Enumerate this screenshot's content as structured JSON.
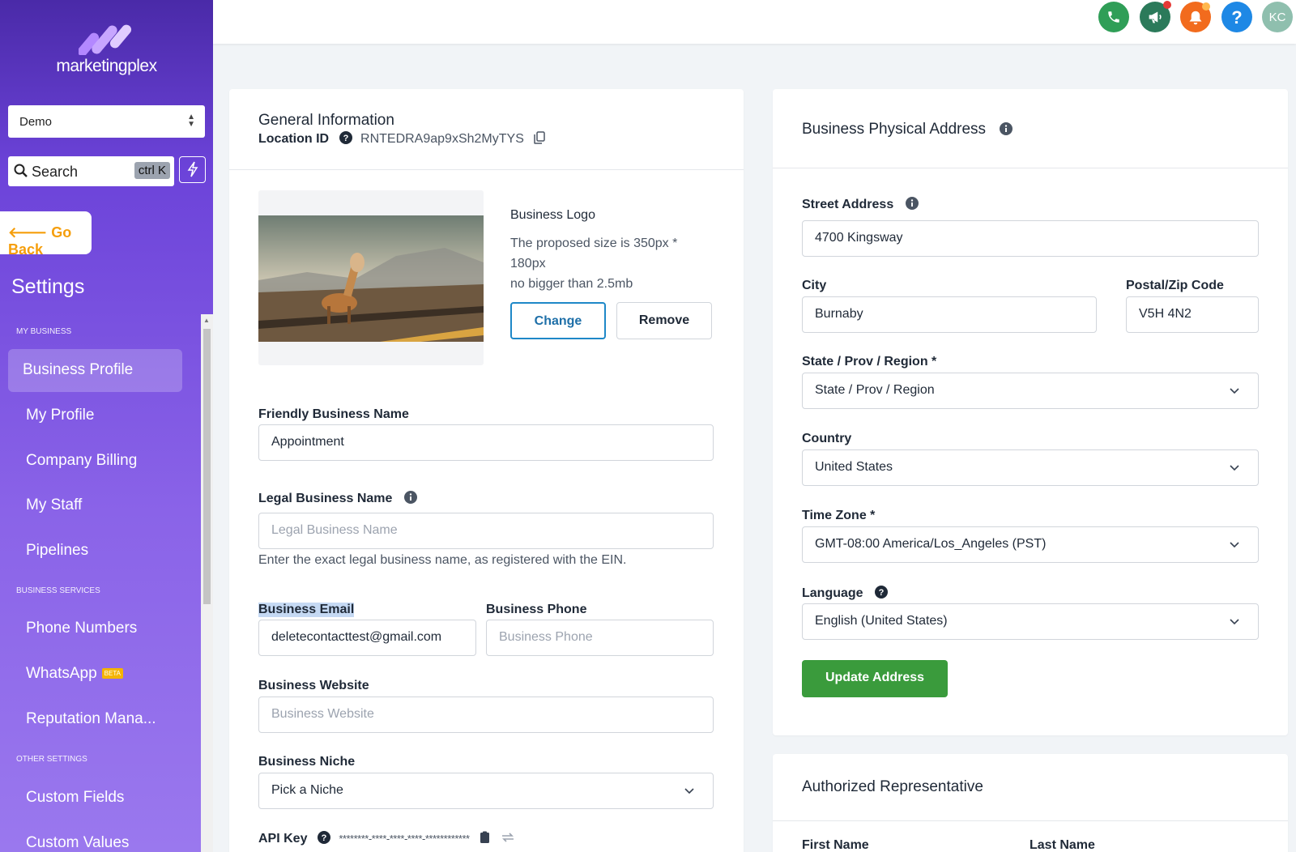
{
  "brand": {
    "name": "marketingplex"
  },
  "sidebar": {
    "location": "Demo",
    "search_label": "Search",
    "search_shortcut": "ctrl K",
    "go_back": "Go Back",
    "title": "Settings",
    "sections": {
      "my_business": "MY BUSINESS",
      "business_services": "BUSINESS SERVICES",
      "other_settings": "OTHER SETTINGS"
    },
    "items": {
      "business_profile": "Business Profile",
      "my_profile": "My Profile",
      "company_billing": "Company Billing",
      "my_staff": "My Staff",
      "pipelines": "Pipelines",
      "phone_numbers": "Phone Numbers",
      "whatsapp": "WhatsApp",
      "whatsapp_badge": "BETA",
      "reputation": "Reputation Mana...",
      "custom_fields": "Custom Fields",
      "custom_values": "Custom Values"
    }
  },
  "topbar": {
    "avatar_initials": "KC",
    "help_label": "?",
    "colors": {
      "phone": "#2f9e57",
      "megaphone": "#2b7a5a",
      "bell": "#f26b1d",
      "help": "#1e88e5",
      "avatar": "#8fbfae"
    }
  },
  "general": {
    "title": "General Information",
    "location_id_label": "Location ID",
    "location_id": "RNTEDRA9ap9xSh2MyTYS",
    "logo_title": "Business Logo",
    "logo_hint_1": "The proposed size is 350px *",
    "logo_hint_2": "180px",
    "logo_hint_3": "no bigger than 2.5mb",
    "change_label": "Change",
    "remove_label": "Remove",
    "friendly_name_label": "Friendly Business Name",
    "friendly_name_value": "Appointment",
    "legal_name_label": "Legal Business Name",
    "legal_name_placeholder": "Legal Business Name",
    "legal_name_help": "Enter the exact legal business name, as registered with the EIN.",
    "email_label": "Business Email",
    "email_value": "deletecontacttest@gmail.com",
    "phone_label": "Business Phone",
    "phone_placeholder": "Business Phone",
    "website_label": "Business Website",
    "website_placeholder": "Business Website",
    "niche_label": "Business Niche",
    "niche_value": "Pick a Niche",
    "api_key_label": "API Key",
    "api_key_value": "********-****-****-****-************"
  },
  "address": {
    "title": "Business Physical Address",
    "street_label": "Street Address",
    "street_value": "4700 Kingsway",
    "city_label": "City",
    "city_value": "Burnaby",
    "postal_label": "Postal/Zip Code",
    "postal_value": "V5H 4N2",
    "state_label": "State / Prov / Region *",
    "state_value": "State / Prov / Region",
    "country_label": "Country",
    "country_value": "United States",
    "timezone_label": "Time Zone *",
    "timezone_value": "GMT-08:00 America/Los_Angeles (PST)",
    "language_label": "Language",
    "language_value": "English (United States)",
    "update_label": "Update Address",
    "update_color": "#3a9b3c"
  },
  "representative": {
    "title": "Authorized Representative",
    "first_name_label": "First Name",
    "last_name_label": "Last Name"
  }
}
